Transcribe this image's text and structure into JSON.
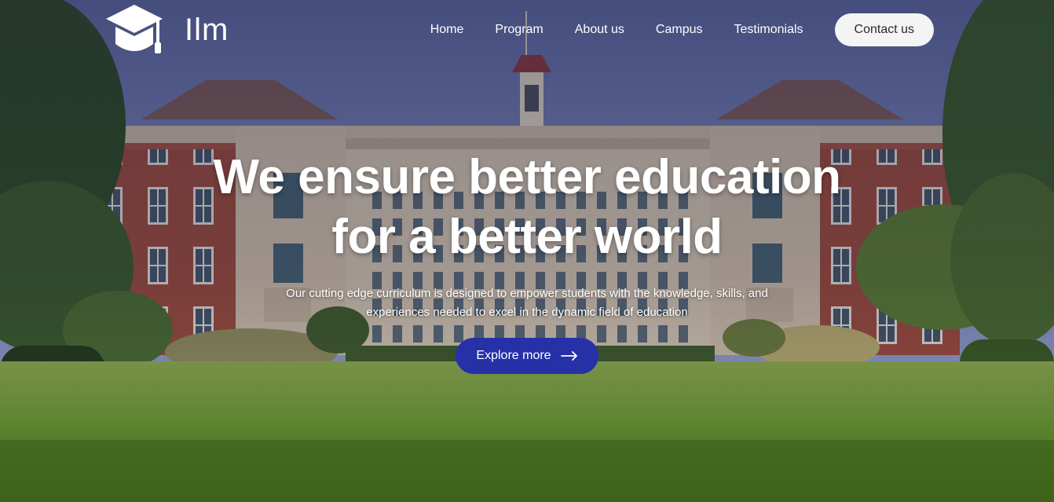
{
  "brand": {
    "name": "Ilm",
    "icon": "graduation-cap-icon"
  },
  "nav": {
    "items": [
      {
        "label": "Home"
      },
      {
        "label": "Program"
      },
      {
        "label": "About us"
      },
      {
        "label": "Campus"
      },
      {
        "label": "Testimonials"
      }
    ],
    "contact_label": "Contact us"
  },
  "hero": {
    "title_line1": "We ensure better education",
    "title_line2": "for a better world",
    "subtitle": "Our cutting edge curriculum is designed to empower students with the knowledge, skills, and experiences needed to excel in the dynamic field of education",
    "cta_label": "Explore more",
    "cta_icon": "arrow-right-icon"
  },
  "colors": {
    "primary": "#2631a8",
    "contact_bg": "#f4f4f4",
    "text_light": "#ffffff"
  }
}
